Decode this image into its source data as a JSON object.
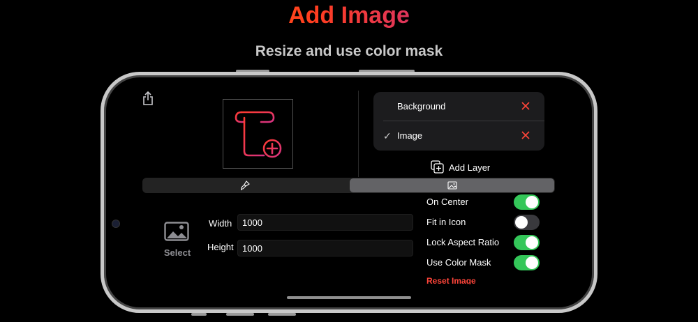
{
  "header": {
    "title": "Add Image",
    "subtitle": "Resize and use color mask"
  },
  "layers": [
    {
      "name": "Background",
      "selected": false,
      "check": ""
    },
    {
      "name": "Image",
      "selected": true,
      "check": "✓"
    }
  ],
  "add_layer_label": "Add Layer",
  "tabs": [
    {
      "icon": "brush-icon",
      "active": false
    },
    {
      "icon": "image-icon",
      "active": true
    }
  ],
  "select_label": "Select",
  "size": {
    "width_label": "Width",
    "width_value": "1000",
    "height_label": "Height",
    "height_value": "1000"
  },
  "toggles": [
    {
      "label": "On Center",
      "on": true
    },
    {
      "label": "Fit in Icon",
      "on": false
    },
    {
      "label": "Lock Aspect Ratio",
      "on": true
    },
    {
      "label": "Use Color Mask",
      "on": true
    }
  ],
  "reset_label": "Reset Image",
  "colors": {
    "accent_pink": "#e8347a",
    "delete_red": "#ff453a",
    "toggle_on": "#34c759"
  }
}
